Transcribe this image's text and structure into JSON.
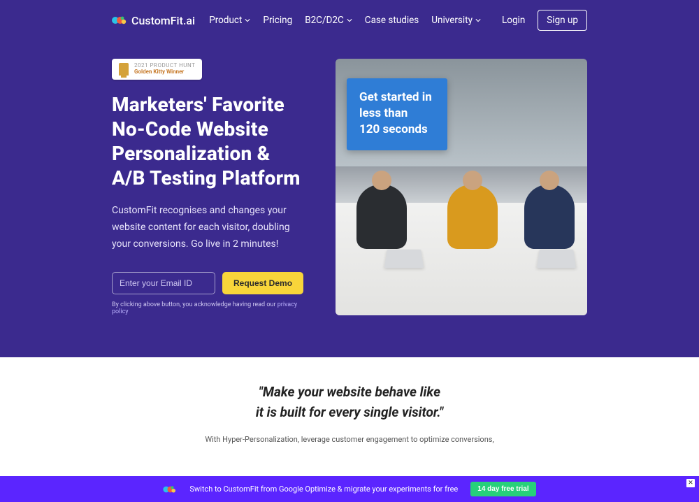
{
  "brand": {
    "name": "CustomFit.ai"
  },
  "nav": {
    "product": "Product",
    "pricing": "Pricing",
    "b2c": "B2C/D2C",
    "caseStudies": "Case studies",
    "university": "University",
    "login": "Login",
    "signup": "Sign up"
  },
  "badge": {
    "line1": "2021 PRODUCT HUNT",
    "line2": "Golden Kitty Winner"
  },
  "hero": {
    "titleLine1": "Marketers' Favorite",
    "titleLine2": "No-Code Website",
    "titleLine3": "Personalization &",
    "titleLine4": "A/B Testing Platform",
    "subtitle": "CustomFit recognises and changes your website content for each visitor, doubling your conversions. Go live in 2 minutes!",
    "emailPlaceholder": "Enter your Email ID",
    "demoButton": "Request Demo",
    "disclaimerPrefix": "By clicking above button, you acknowledge having read our ",
    "privacyLink": "privacy policy",
    "overlayLine1": "Get started in",
    "overlayLine2": "less than",
    "overlayLine3": "120 seconds"
  },
  "section2": {
    "quoteLine1": "\"Make your website behave like",
    "quoteLine2": "it is built for every single visitor.\"",
    "subtext": "With Hyper-Personalization, leverage customer engagement to optimize conversions,"
  },
  "bottomBar": {
    "text": "Switch to CustomFit from Google Optimize & migrate your experiments for free",
    "cta": "14 day free trial",
    "close": "✕"
  }
}
